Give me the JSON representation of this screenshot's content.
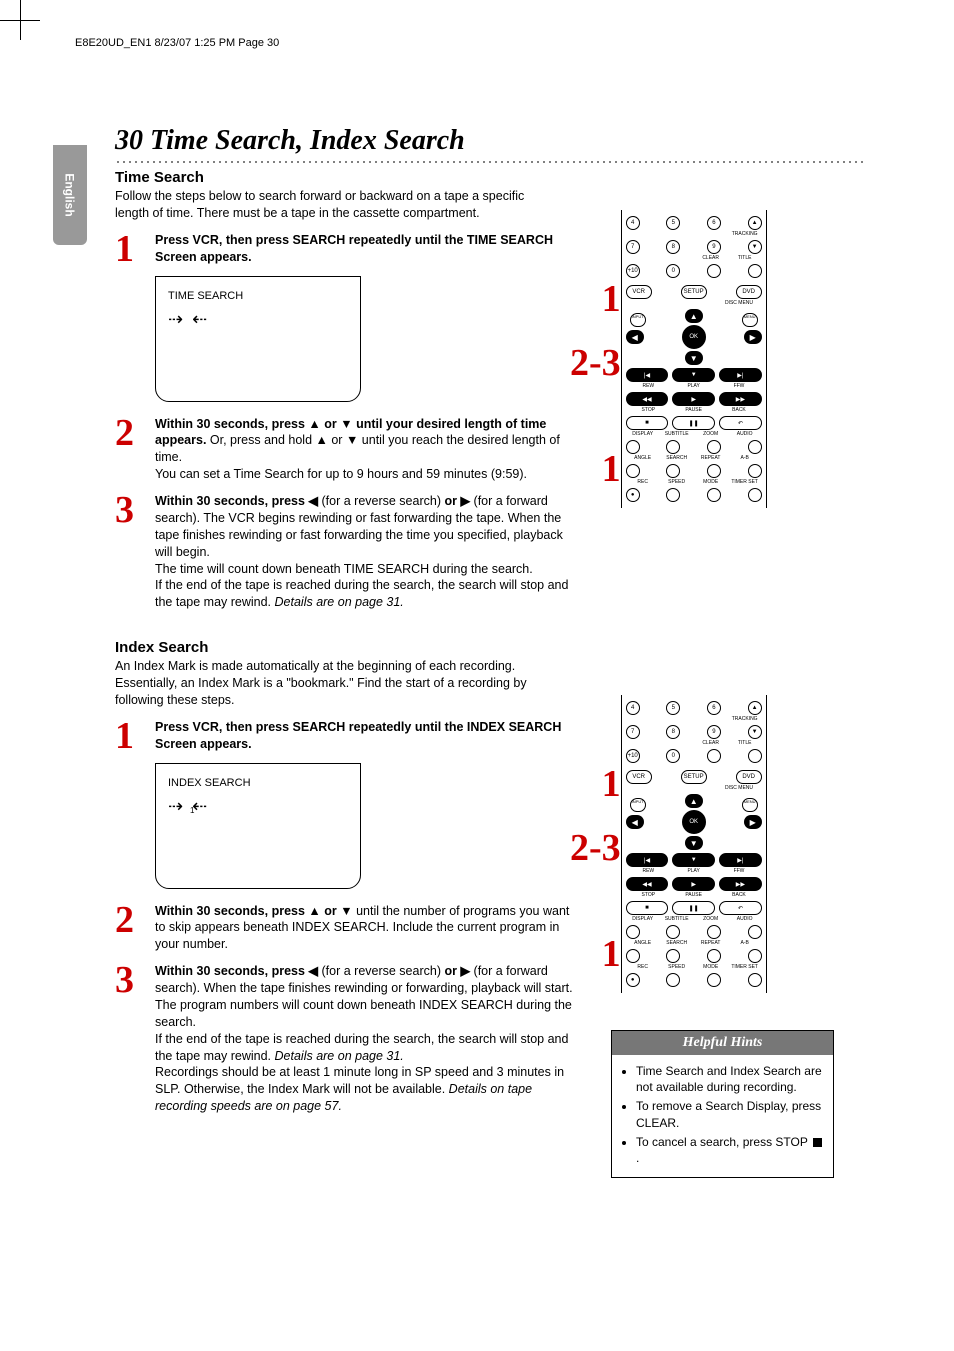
{
  "header": "E8E20UD_EN1  8/23/07  1:25 PM  Page 30",
  "sideTab": "English",
  "chapterTitle": "30  Time Search, Index Search",
  "timeSearch": {
    "title": "Time Search",
    "intro": "Follow the steps below to search forward or backward on a tape a specific length of time. There must be a tape in the cassette compartment.",
    "step1": "Press VCR, then press SEARCH repeatedly until the TIME SEARCH Screen appears.",
    "screenLabel": "TIME SEARCH",
    "step2a": "Within 30 seconds, press ▲ or ▼ until your desired length of time appears.",
    "step2b": " Or, press and hold ▲ or ▼ until you reach the desired length of time.",
    "step2c": "You can set a Time Search for up to 9 hours and 59 minutes (9:59).",
    "step3a": "Within 30 seconds, press ◀",
    "step3b": " (for a reverse search) ",
    "step3c": "or ▶",
    "step3d": " (for a forward search). The VCR begins rewinding or fast forwarding the tape. When the tape finishes rewinding or fast forwarding the time you specified, playback will begin.",
    "step3e": "The time will count down beneath TIME SEARCH during the search.",
    "step3f": "If the end of the tape is reached during the search, the search will stop and the tape may rewind. ",
    "step3g": "Details are on page 31."
  },
  "indexSearch": {
    "title": "Index Search",
    "intro": "An Index Mark is made automatically at the beginning of each recording. Essentially, an Index Mark is a \"bookmark.\" Find the start of a recording by following these steps.",
    "step1": "Press VCR, then press SEARCH repeatedly until the INDEX SEARCH Screen appears.",
    "screenLabel": "INDEX SEARCH",
    "step2a": "Within 30 seconds, press ▲ or ▼",
    "step2b": " until the number of programs you want to skip appears beneath INDEX SEARCH. Include the current program in your number.",
    "step3a": "Within 30 seconds, press ◀",
    "step3b": " (for a reverse search) ",
    "step3c": "or ▶",
    "step3d": " (for a forward search). When the tape finishes rewinding or forwarding, playback will start. The program numbers will count down beneath INDEX SEARCH during the search.",
    "step3e": "If the end of the tape is reached during the search, the search will stop and the tape may rewind. ",
    "step3f": "Details are on page 31.",
    "step3g": "Recordings should be at least 1 minute long in SP speed and 3 minutes in SLP. Otherwise, the Index Mark will not be available. ",
    "step3h": "Details on tape recording speeds are on page 57."
  },
  "hints": {
    "title": "Helpful Hints",
    "item1": "Time Search and Index Search are not available during recording.",
    "item2": "To remove a Search Display, press CLEAR.",
    "item3": "To cancel a search, press STOP "
  },
  "remote": {
    "numbers": [
      "4",
      "5",
      "6",
      "7",
      "8",
      "9",
      "+10",
      "0"
    ],
    "topLabels": [
      "TRACKING",
      "CLEAR",
      "TITLE"
    ],
    "modeRow": [
      "VCR",
      "SETUP",
      "DVD"
    ],
    "discMenu": [
      "DISC MENU"
    ],
    "input": "INPUT",
    "menu": "MENU",
    "ok": "OK",
    "transport": [
      "REW",
      "PLAY",
      "FFW",
      "STOP",
      "PAUSE",
      "BACK"
    ],
    "bottomRow1": [
      "DISPLAY",
      "SUBTITLE",
      "ZOOM",
      "AUDIO"
    ],
    "bottomRow2": [
      "ANGLE",
      "SEARCH",
      "REPEAT",
      "REPEAT A-B"
    ],
    "bottomRow3": [
      "REC",
      "SPEED",
      "MODE",
      "TIMER SET"
    ]
  },
  "markers": {
    "one": "1",
    "twoThree": "2-3"
  }
}
